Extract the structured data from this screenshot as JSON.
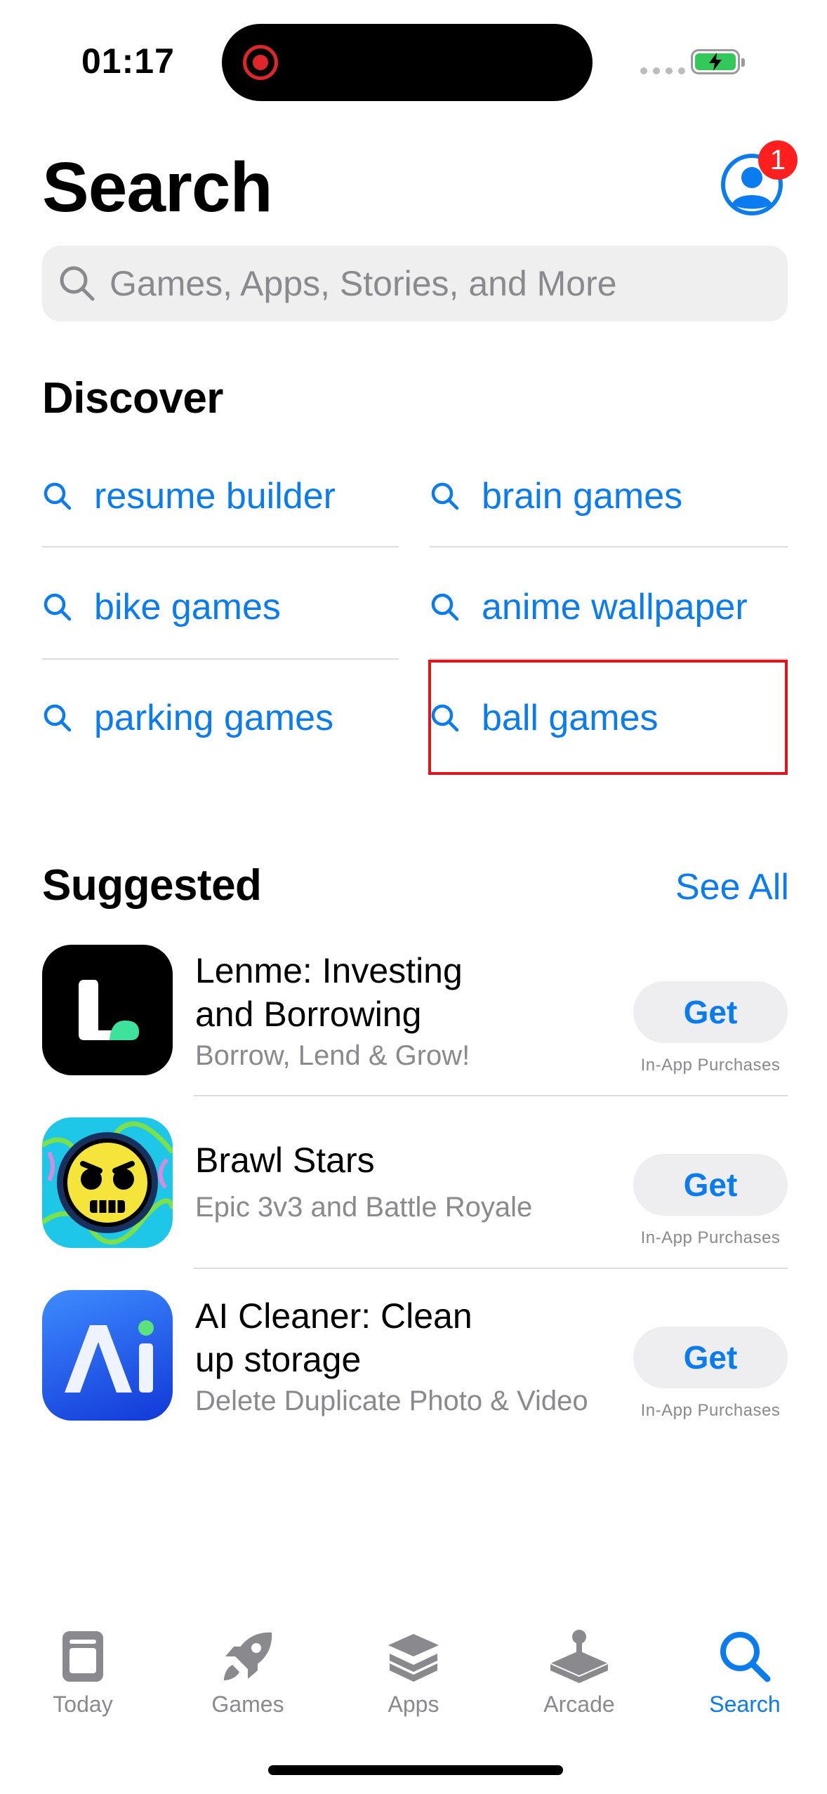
{
  "status_bar": {
    "time": "01:17"
  },
  "header": {
    "title": "Search",
    "notification_count": "1"
  },
  "search": {
    "placeholder": "Games, Apps, Stories, and More"
  },
  "discover": {
    "title": "Discover",
    "items": [
      {
        "label": "resume builder"
      },
      {
        "label": "brain games"
      },
      {
        "label": "bike games"
      },
      {
        "label": "anime wallpaper"
      },
      {
        "label": "parking games"
      },
      {
        "label": "ball games"
      }
    ]
  },
  "suggested": {
    "title": "Suggested",
    "see_all": "See All",
    "apps": [
      {
        "name_line1": "Lenme: Investing",
        "name_line2": "and Borrowing",
        "subtitle": "Borrow, Lend & Grow!",
        "button": "Get",
        "note": "In-App Purchases"
      },
      {
        "name_line1": "Brawl Stars",
        "subtitle": "Epic 3v3 and Battle Royale",
        "button": "Get",
        "note": "In-App Purchases"
      },
      {
        "name_line1": "AI Cleaner: Clean",
        "name_line2": "up storage",
        "subtitle": "Delete Duplicate Photo & Video",
        "button": "Get",
        "note": "In-App Purchases"
      }
    ]
  },
  "tabbar": {
    "items": [
      {
        "label": "Today",
        "icon": "today-icon"
      },
      {
        "label": "Games",
        "icon": "rocket-icon"
      },
      {
        "label": "Apps",
        "icon": "layers-icon"
      },
      {
        "label": "Arcade",
        "icon": "joystick-icon"
      },
      {
        "label": "Search",
        "icon": "search-icon",
        "active": true
      }
    ]
  },
  "colors": {
    "accent": "#0a7cf0",
    "badge": "#ff1f1f",
    "highlight": "#e0141c",
    "battery": "#34c759"
  }
}
